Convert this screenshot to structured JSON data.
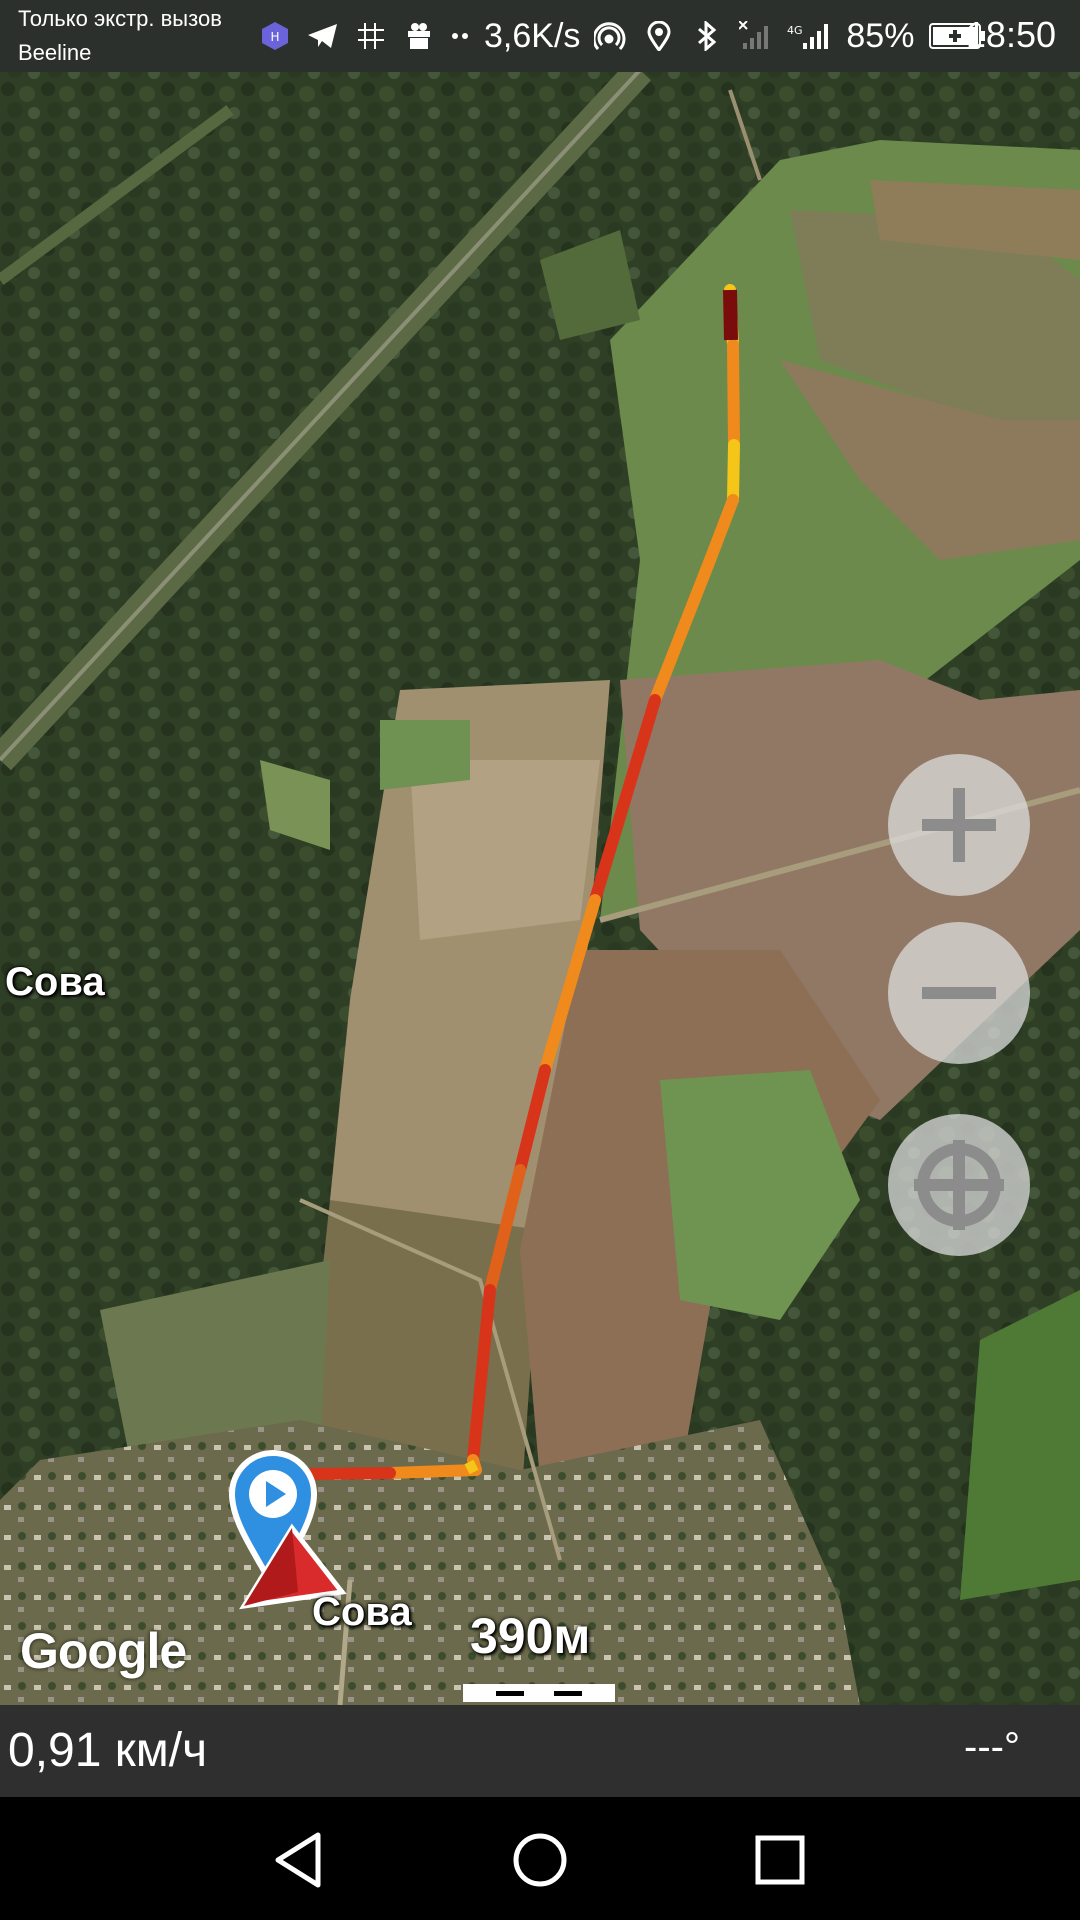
{
  "status_bar": {
    "carrier_line1": "Только экстр. вызов",
    "carrier_line2": "Beeline",
    "net_speed": "3,6K/s",
    "battery": "85%",
    "time": "18:50",
    "icons": [
      "vpn-icon",
      "telegram-icon",
      "grid-icon",
      "gift-icon",
      "more-dots-icon",
      "hotspot-icon",
      "location-icon",
      "bluetooth-icon",
      "no-sim-signal-icon",
      "4g-signal-icon",
      "battery-icon"
    ]
  },
  "map": {
    "place_labels": [
      "Сова",
      "Сова"
    ],
    "attribution": "Google",
    "scale_label": "390м"
  },
  "controls": {
    "zoom_in": "zoom-in-button",
    "zoom_out": "zoom-out-button",
    "locate": "my-location-button"
  },
  "info_bar": {
    "speed": "0,91 км/ч",
    "heading": "---°"
  },
  "colors": {
    "track_yellow": "#f5c518",
    "track_orange": "#f08a1c",
    "track_red": "#d8341a",
    "track_darkred": "#7a0c0c",
    "start_marker": "#2f8fe0",
    "position_arrow": "#d92b2b"
  }
}
